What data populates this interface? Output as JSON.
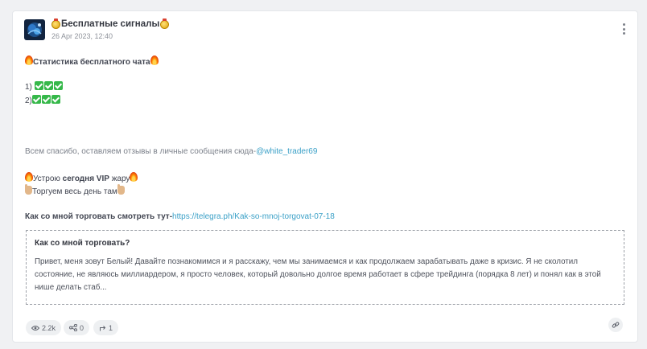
{
  "post": {
    "channel_name": "Бесплатные сигналы",
    "date": "26 Apr 2023, 12:40",
    "heading": "Статистика бесплатного чата",
    "signal_rows": [
      {
        "label": "1)",
        "checks": 3
      },
      {
        "label": "2)",
        "checks": 3
      }
    ],
    "thanks_text": "Всем спасибо, оставляем отзывы в личные сообщения сюда-",
    "thanks_handle": "@white_trader69",
    "vip_before": "Устрою ",
    "vip_bold": "сегодня VIP",
    "vip_after": " жару",
    "trade_line": "Торгуем весь день там",
    "howto_label": "Как со мной торговать смотреть тут-",
    "howto_url": "https://telegra.ph/Kak-so-mnoj-torgovat-07-18"
  },
  "preview": {
    "title": "Как со мной торговать?",
    "text": "Привет, меня зовут Белый! Давайте познакомимся и я расскажу, чем мы занимаемся и как продолжаем зарабатывать даже в кризис. Я не сколотил состояние, не являюсь миллиардером, я просто человек, который довольно долгое время работает в сфере трейдинга (порядка 8 лет) и понял как в этой нише делать стаб..."
  },
  "stats": {
    "views": "2.2k",
    "forwards": "0",
    "shares": "1"
  },
  "colors": {
    "link": "#3aa0c7",
    "check": "#36b84a",
    "card_bg": "#ffffff",
    "page_bg": "#f0f1f3"
  },
  "icons": [
    "avatar-image",
    "medal-icon",
    "fire-icon",
    "check-icon",
    "pointing-hand-icon",
    "eye-icon",
    "forward-icon",
    "reply-icon",
    "link-icon",
    "more-icon"
  ]
}
